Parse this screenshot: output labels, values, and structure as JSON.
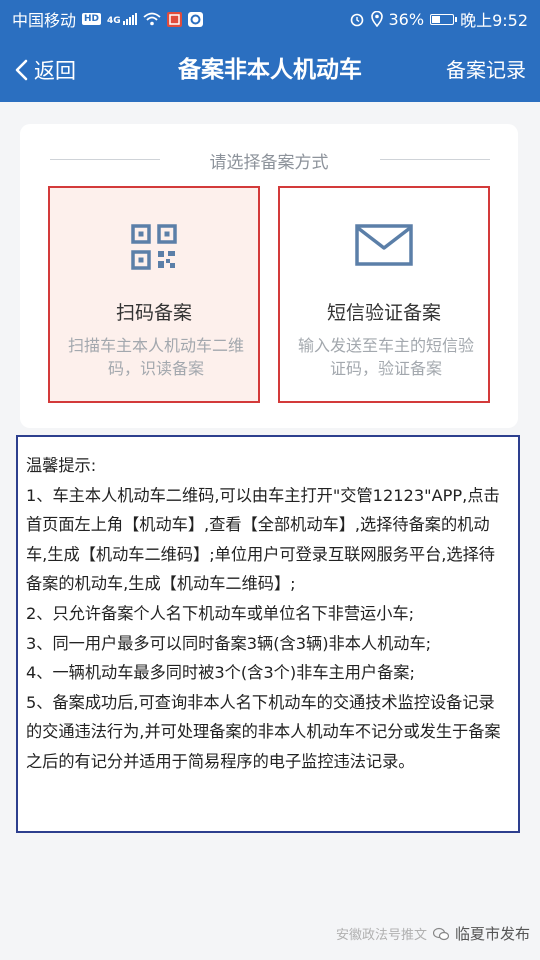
{
  "status_bar": {
    "carrier": "中国移动",
    "hd_badge": "HD",
    "network": "4G",
    "battery_percent": "36%",
    "battery_level": 0.36,
    "time": "晚上9:52",
    "icons": [
      "signal-icon",
      "wifi-icon",
      "app-icon",
      "alarm-icon",
      "location-icon",
      "battery-icon"
    ]
  },
  "nav": {
    "back_label": "返回",
    "title": "备案非本人机动车",
    "records_label": "备案记录"
  },
  "selector": {
    "heading": "请选择备案方式",
    "options": [
      {
        "name": "扫码备案",
        "desc": "扫描车主本人机动车二维码，识读备案",
        "icon": "qr-code-icon"
      },
      {
        "name": "短信验证备案",
        "desc": "输入发送至车主的短信验证码，验证备案",
        "icon": "envelope-icon"
      }
    ]
  },
  "tips": {
    "title": "温馨提示:",
    "items": [
      "1、车主本人机动车二维码,可以由车主打开\"交管12123\"APP,点击首页面左上角【机动车】,查看【全部机动车】,选择待备案的机动车,生成【机动车二维码】;单位用户可登录互联网服务平台,选择待备案的机动车,生成【机动车二维码】;",
      "2、只允许备案个人名下机动车或单位名下非营运小车;",
      "3、同一用户最多可以同时备案3辆(含3辆)非本人机动车;",
      "4、一辆机动车最多同时被3个(含3个)非车主用户备案;",
      "5、备案成功后,可查询非本人名下机动车的交通技术监控设备记录的交通违法行为,并可处理备案的非本人机动车不记分或发生于备案之后的有记分并适用于简易程序的电子监控违法记录。"
    ]
  },
  "watermark": {
    "text": "临夏市发布",
    "source": "安徽政法号推文"
  },
  "colors": {
    "header_blue": "#2b6fc0",
    "option_border": "#d33a3a",
    "tips_border": "#2d3f8e",
    "icon_blue": "#5b7fa8"
  }
}
